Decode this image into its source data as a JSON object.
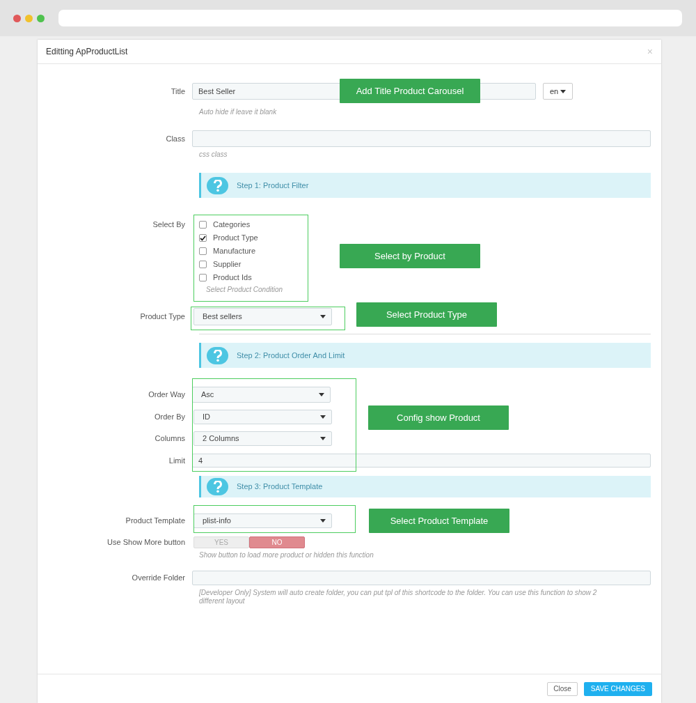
{
  "modal": {
    "title": "Editting ApProductList",
    "close": "×",
    "fields": [
      {
        "kind": "text",
        "label": "Title",
        "value": "Best Seller",
        "lang": "en",
        "help": "Auto hide if leave it blank"
      },
      {
        "kind": "text",
        "label": "Class",
        "help": "css class"
      },
      {
        "kind": "step",
        "text": "Step 1: Product Filter"
      },
      {
        "kind": "checkboxes",
        "label": "Select By",
        "options": [
          {
            "label": "Categories",
            "checked": false
          },
          {
            "label": "Product Type",
            "checked": true
          },
          {
            "label": "Manufacture",
            "checked": false
          },
          {
            "label": "Supplier",
            "checked": false
          },
          {
            "label": "Product Ids",
            "checked": false
          }
        ],
        "help": "Select Product Condition"
      },
      {
        "kind": "select",
        "label": "Product Type",
        "value": "Best sellers"
      },
      {
        "kind": "divider"
      },
      {
        "kind": "step",
        "text": "Step 2: Product Order And Limit"
      },
      {
        "kind": "select",
        "label": "Order Way",
        "value": "Asc"
      },
      {
        "kind": "select",
        "label": "Order By",
        "value": "ID"
      },
      {
        "kind": "select",
        "label": "Columns",
        "value": "2 Columns"
      },
      {
        "kind": "text",
        "label": "Limit",
        "value": "4"
      },
      {
        "kind": "step",
        "text": "Step 3: Product Template"
      },
      {
        "kind": "select",
        "label": "Product Template",
        "value": "plist-info"
      },
      {
        "kind": "toggle",
        "label": "Use Show More button",
        "options": [
          {
            "label": "YES",
            "selected": false
          },
          {
            "label": "NO",
            "selected": true
          }
        ],
        "help": "Show button to load more product or hidden this function"
      },
      {
        "kind": "text",
        "label": "Override Folder",
        "help": "[Developer Only] System will auto create folder, you can put tpl of this shortcode to the folder. You can use this function to show 2 different layout"
      }
    ],
    "buttons": [
      {
        "label": "Close",
        "kind": "default"
      },
      {
        "label": "SAVE CHANGES",
        "kind": "primary"
      }
    ]
  },
  "annotations": [
    "Add Title Product Carousel",
    "Select by Product",
    "Select Product Type",
    "Config show Product",
    "Select Product Template"
  ]
}
